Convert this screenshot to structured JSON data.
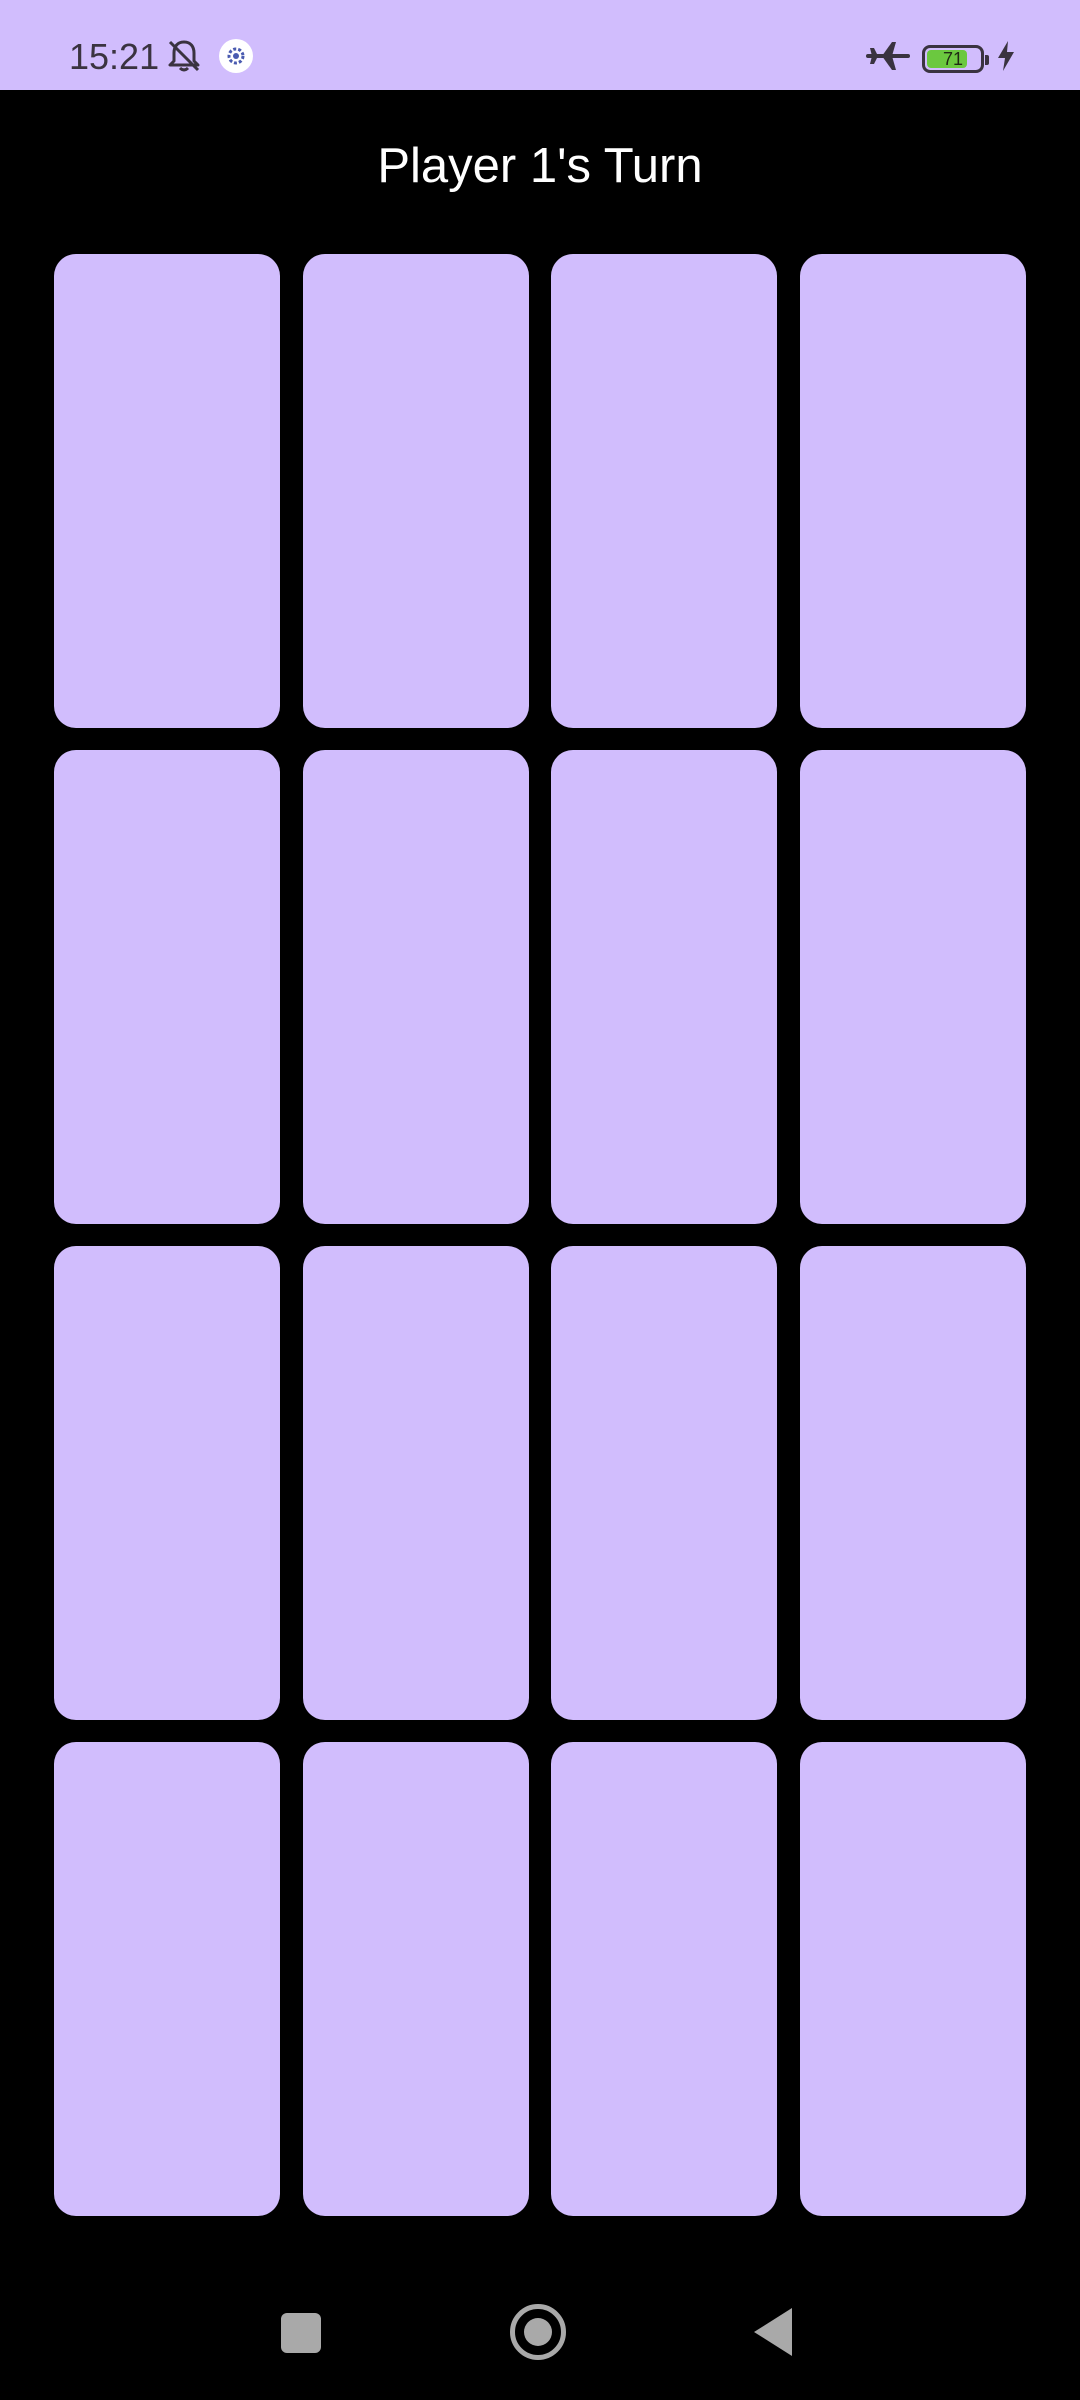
{
  "status_bar": {
    "time": "15:21",
    "battery_level": "71",
    "icons": [
      "bell-off-icon",
      "settings-badge-icon",
      "airplane-mode-icon",
      "battery-icon",
      "charging-bolt-icon"
    ]
  },
  "game": {
    "title": "Player 1's Turn",
    "cards": [
      {
        "state": "face-down"
      },
      {
        "state": "face-down"
      },
      {
        "state": "face-down"
      },
      {
        "state": "face-down"
      },
      {
        "state": "face-down"
      },
      {
        "state": "face-down"
      },
      {
        "state": "face-down"
      },
      {
        "state": "face-down"
      },
      {
        "state": "face-down"
      },
      {
        "state": "face-down"
      },
      {
        "state": "face-down"
      },
      {
        "state": "face-down"
      },
      {
        "state": "face-down"
      },
      {
        "state": "face-down"
      },
      {
        "state": "face-down"
      },
      {
        "state": "face-down"
      }
    ]
  },
  "nav_bar": {
    "icons": [
      "recent-apps-icon",
      "home-icon",
      "back-icon"
    ]
  },
  "colors": {
    "background": "#000000",
    "accent": "#d1bdfd",
    "title_text": "#ffffff",
    "nav_icon": "#a9a9a9"
  }
}
